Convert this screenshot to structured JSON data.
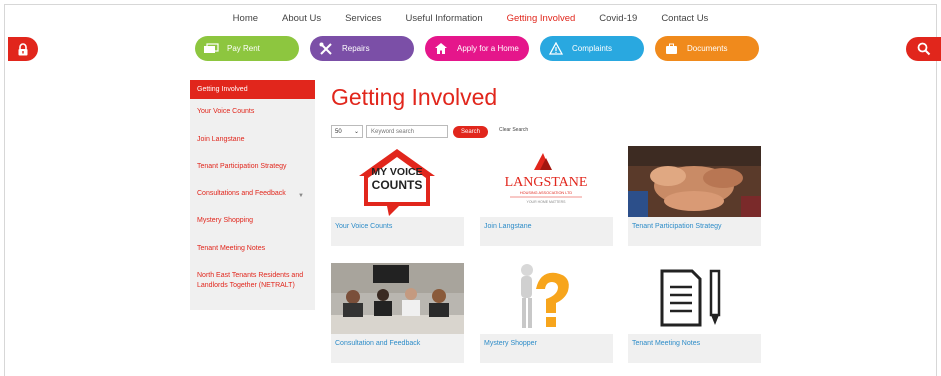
{
  "nav": {
    "items": [
      {
        "label": "Home",
        "active": false
      },
      {
        "label": "About Us",
        "active": false
      },
      {
        "label": "Services",
        "active": false
      },
      {
        "label": "Useful Information",
        "active": false
      },
      {
        "label": "Getting Involved",
        "active": true
      },
      {
        "label": "Covid-19",
        "active": false
      },
      {
        "label": "Contact Us",
        "active": false
      }
    ]
  },
  "side_tabs": {
    "left_icon": "lock-icon",
    "right_icon": "search-icon"
  },
  "actions": [
    {
      "label": "Pay Rent",
      "color": "#8dc63f",
      "icon": "cash-icon"
    },
    {
      "label": "Repairs",
      "color": "#7b4fa7",
      "icon": "tools-icon"
    },
    {
      "label": "Apply for a Home",
      "color": "#e5168b",
      "icon": "house-icon"
    },
    {
      "label": "Complaints",
      "color": "#29a8e0",
      "icon": "warning-icon"
    },
    {
      "label": "Documents",
      "color": "#f08a1c",
      "icon": "briefcase-icon"
    }
  ],
  "sidebar": {
    "heading": "Getting Involved",
    "items": [
      {
        "label": "Your Voice Counts"
      },
      {
        "label": "Join Langstane"
      },
      {
        "label": "Tenant Participation Strategy"
      },
      {
        "label": "Consultations and Feedback",
        "has_submenu": true
      },
      {
        "label": "Mystery Shopping"
      },
      {
        "label": "Tenant Meeting Notes"
      },
      {
        "label": "North East Tenants Residents and Landlords Together (NETRALT)"
      }
    ]
  },
  "main": {
    "title": "Getting Involved",
    "per_page": "50",
    "search_placeholder": "Keyword search",
    "search_label": "Search",
    "clear_label": "Clear Search",
    "cards": [
      {
        "caption": "Your Voice Counts",
        "logo_line1": "MY VOICE",
        "logo_line2": "COUNTS"
      },
      {
        "caption": "Join Langstane",
        "logo_name": "LANGSTANE",
        "logo_sub": "HOUSING ASSOCIATION LTD",
        "logo_tag": "YOUR HOME MATTERS"
      },
      {
        "caption": "Tenant Participation Strategy"
      },
      {
        "caption": "Consultation and Feedback"
      },
      {
        "caption": "Mystery Shopper"
      },
      {
        "caption": "Tenant Meeting Notes"
      }
    ]
  },
  "colors": {
    "brand_red": "#e1261c",
    "link_blue": "#2d8cc8"
  }
}
